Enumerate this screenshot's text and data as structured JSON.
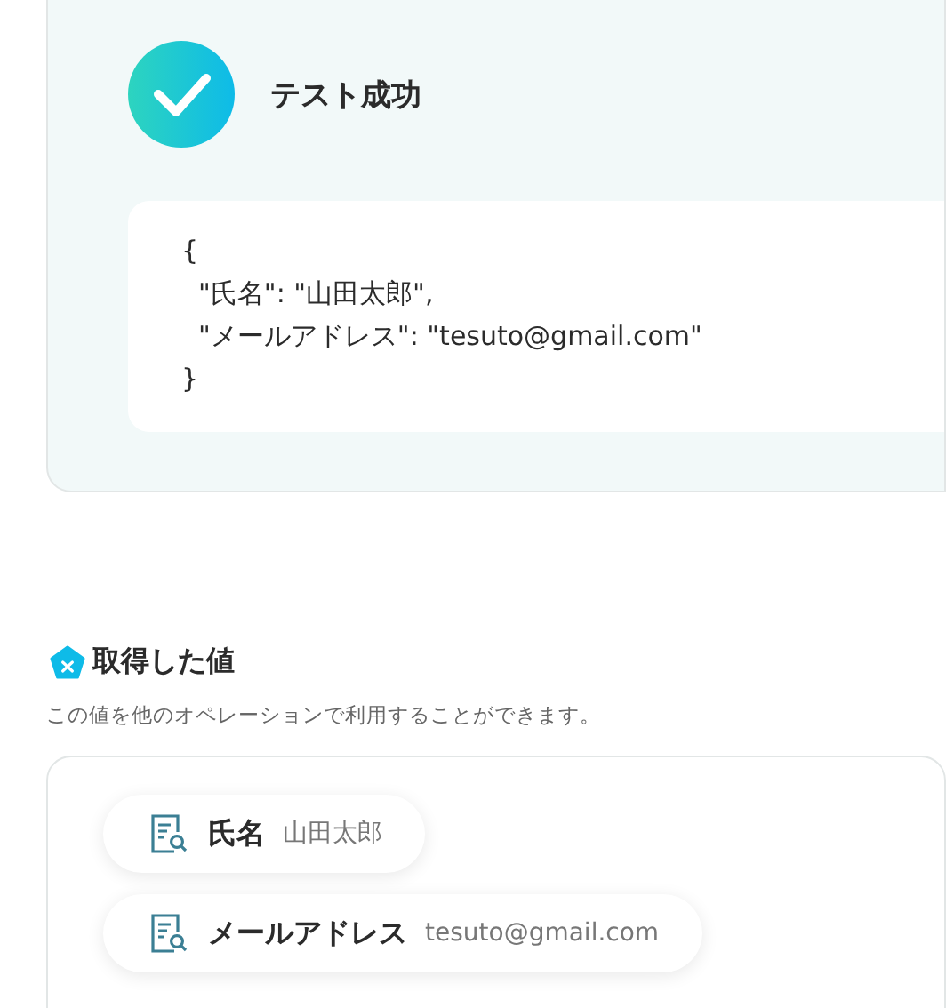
{
  "test_result": {
    "success": true,
    "title": "テスト成功",
    "code_lines": [
      "{",
      "  \"氏名\": \"山田太郎\",",
      "  \"メールアドレス\": \"tesuto@gmail.com\"",
      "}"
    ]
  },
  "fetched_values": {
    "title": "取得した値",
    "description": "この値を他のオペレーションで利用することができます。",
    "items": [
      {
        "label": "氏名",
        "value": "山田太郎"
      },
      {
        "label": "メールアドレス",
        "value": "tesuto@gmail.com"
      }
    ]
  }
}
